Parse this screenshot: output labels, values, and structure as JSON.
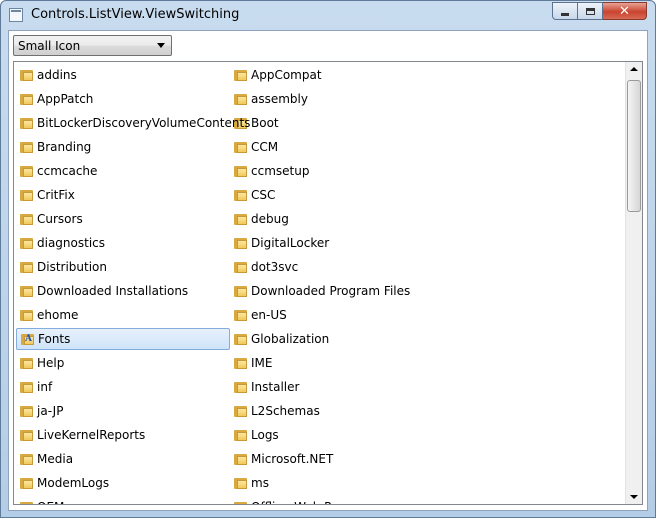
{
  "window": {
    "title": "Controls.ListView.ViewSwitching",
    "minimize_label": "",
    "maximize_label": "",
    "close_label": "✕"
  },
  "view_selector": {
    "selected": "Small Icon"
  },
  "list": {
    "selected_item": "Fonts",
    "column1": [
      "addins",
      "AppPatch",
      "BitLockerDiscoveryVolumeContents",
      "Branding",
      "ccmcache",
      "CritFix",
      "Cursors",
      "diagnostics",
      "Distribution",
      "Downloaded Installations",
      "ehome",
      "Fonts",
      "Help",
      "inf",
      "ja-JP",
      "LiveKernelReports",
      "Media",
      "ModemLogs",
      "OEM"
    ],
    "column2": [
      "AppCompat",
      "assembly",
      "Boot",
      "CCM",
      "ccmsetup",
      "CSC",
      "debug",
      "DigitalLocker",
      "dot3svc",
      "Downloaded Program Files",
      "en-US",
      "Globalization",
      "IME",
      "Installer",
      "L2Schemas",
      "Logs",
      "Microsoft.NET",
      "ms",
      "Offline Web Pages"
    ],
    "scroll_position": 0
  },
  "icons": {
    "folder": "folder-icon",
    "fonts_folder": "fonts-folder-icon"
  }
}
